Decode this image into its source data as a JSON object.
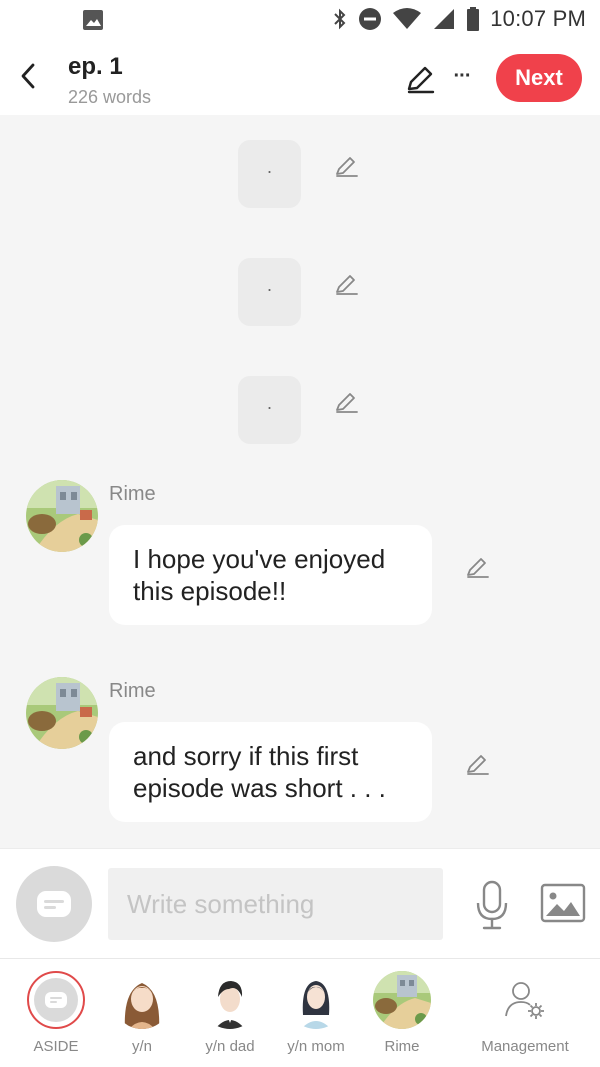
{
  "status_bar": {
    "time": "10:07 PM",
    "icons": [
      "image-icon",
      "bluetooth-icon",
      "do-not-disturb-icon",
      "wifi-icon",
      "signal-icon",
      "battery-icon"
    ]
  },
  "header": {
    "title": "ep. 1",
    "word_count": "226 words",
    "next_label": "Next",
    "more_label": "···",
    "back_icon": "chevron-left-icon",
    "edit_icon": "pencil-icon"
  },
  "chat": {
    "asides": [
      {
        "text": "."
      },
      {
        "text": "."
      },
      {
        "text": "."
      }
    ],
    "messages": [
      {
        "sender": "Rime",
        "text": "I hope you've enjoyed this episode!!"
      },
      {
        "sender": "Rime",
        "text": "and sorry if this first episode was short . . ."
      }
    ]
  },
  "composer": {
    "placeholder": "Write something",
    "value": "",
    "mic_icon": "microphone-icon",
    "image_icon": "image-icon"
  },
  "characters": [
    {
      "label": "ASIDE",
      "selected": true
    },
    {
      "label": "y/n"
    },
    {
      "label": "y/n dad"
    },
    {
      "label": "y/n mom"
    },
    {
      "label": "Rime"
    },
    {
      "label": "Management"
    }
  ],
  "colors": {
    "accent": "#f0414b",
    "background": "#f5f5f5",
    "muted_text": "#888888"
  }
}
